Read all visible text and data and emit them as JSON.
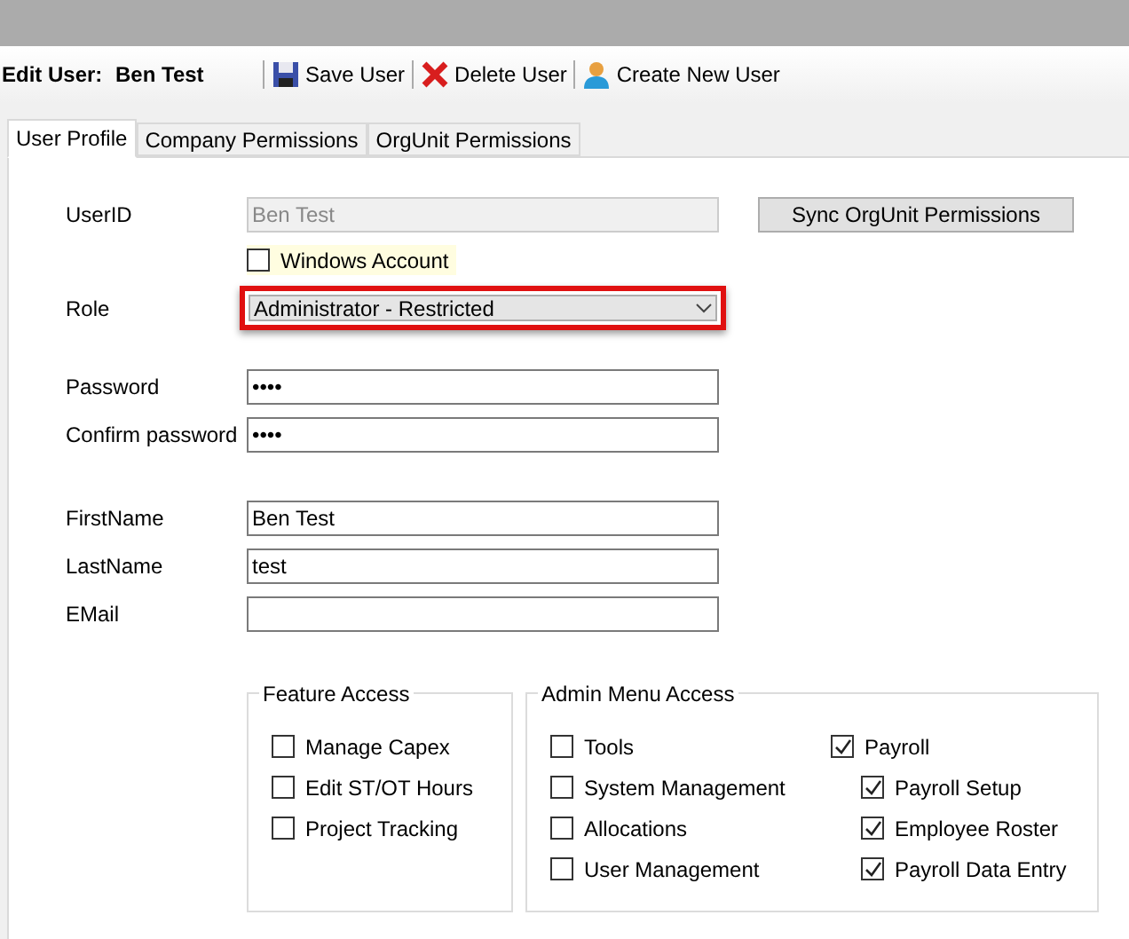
{
  "toolbar": {
    "label": "Edit User:",
    "user_name": "Ben Test",
    "buttons": [
      {
        "kind": "save",
        "label": "Save User"
      },
      {
        "kind": "delete",
        "label": "Delete User"
      },
      {
        "kind": "create",
        "label": "Create New User"
      }
    ]
  },
  "tabs": [
    {
      "label": "User Profile",
      "selected": true
    },
    {
      "label": "Company Permissions",
      "selected": false
    },
    {
      "label": "OrgUnit Permissions",
      "selected": false
    }
  ],
  "user_id": {
    "label": "UserID",
    "value": "Ben Test",
    "disabled": true
  },
  "sync_button": "Sync OrgUnit Permissions",
  "windows_account": {
    "label": "Windows Account",
    "checked": false
  },
  "role": {
    "label": "Role",
    "value": "Administrator - Restricted",
    "highlighted": true
  },
  "password": {
    "label": "Password",
    "value": "••••"
  },
  "confirm_password": {
    "label": "Confirm password",
    "value": "••••"
  },
  "first_name": {
    "label": "FirstName",
    "value": "Ben Test"
  },
  "last_name": {
    "label": "LastName",
    "value": "test"
  },
  "email": {
    "label": "EMail"
  },
  "feature_access": {
    "title": "Feature Access",
    "items": [
      {
        "label": "Manage Capex",
        "checked": false
      },
      {
        "label": "Edit ST/OT Hours",
        "checked": false
      },
      {
        "label": "Project Tracking",
        "checked": false
      }
    ]
  },
  "admin_menu_access": {
    "title": "Admin Menu Access",
    "items": [
      {
        "label": "Tools",
        "checked": false
      },
      {
        "label": "System Management",
        "checked": false
      },
      {
        "label": "Allocations",
        "checked": false
      },
      {
        "label": "User Management",
        "checked": false
      },
      {
        "label": "Payroll",
        "checked": true,
        "children": [
          {
            "label": "Payroll Setup",
            "checked": true
          },
          {
            "label": "Employee Roster",
            "checked": true
          },
          {
            "label": "Payroll Data Entry",
            "checked": true
          }
        ]
      }
    ]
  }
}
